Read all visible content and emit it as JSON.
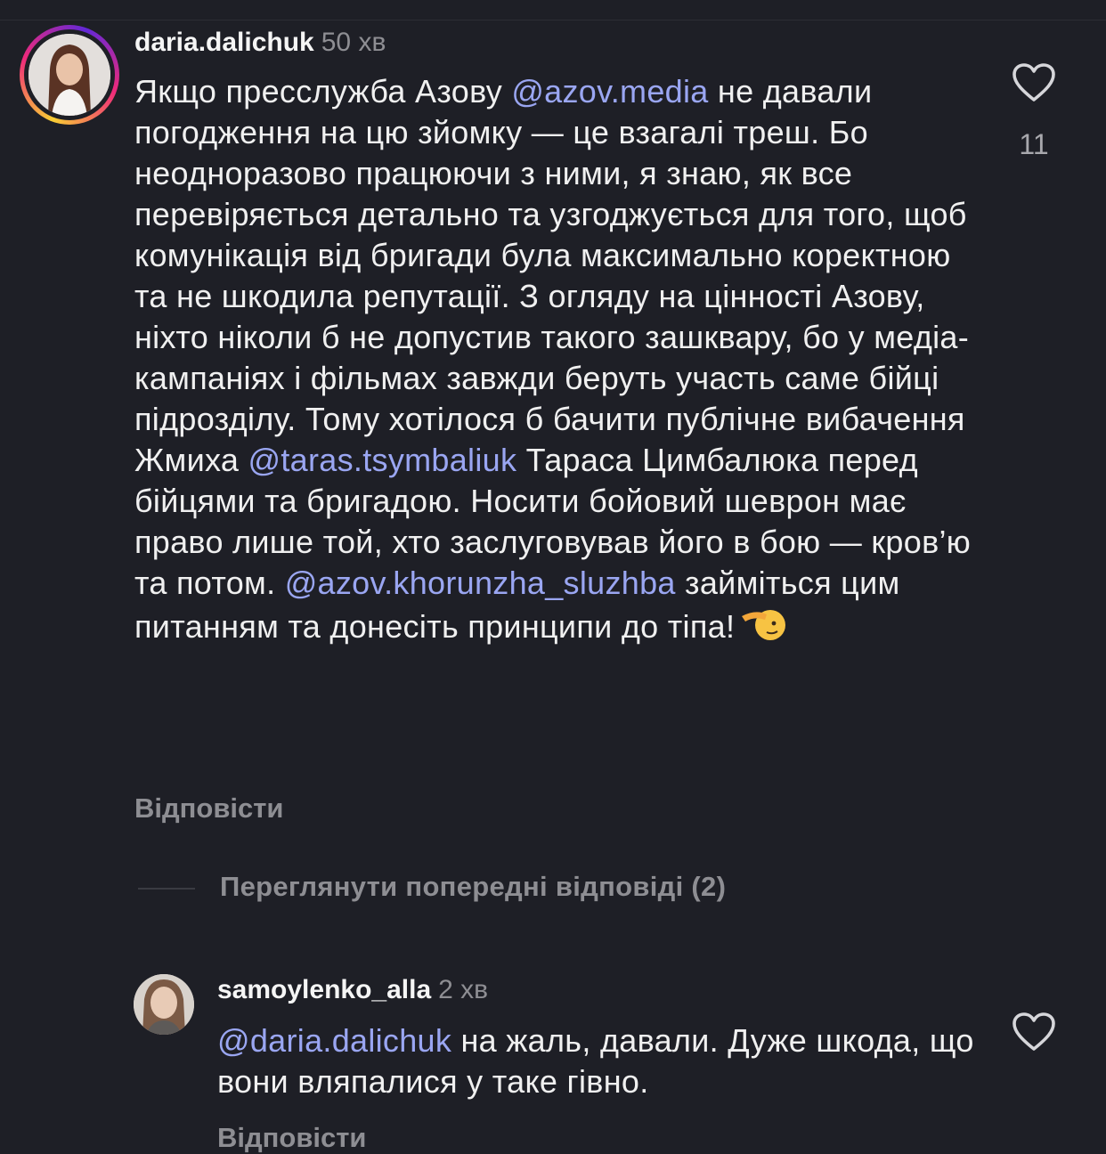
{
  "comments": [
    {
      "username": "daria.dalichuk",
      "time": "50 хв",
      "text_parts": {
        "p1": "Якщо пресслужба Азову ",
        "m1": "@azov.media",
        "p2": " не давали погодження на цю зйомку — це взагалі треш. Бо неодноразово працюючи з ними, я знаю, як все перевіряється детально та узгоджується для того, щоб комунікація від бригади була максимально коректною та не шкодила репутації. З огляду на цінності Азову, ніхто ніколи б не допустив такого зашквару, бо у медіа-кампаніях і фільмах завжди беруть участь саме бійці підрозділу. Тому хотілося б бачити публічне вибачення Жмиха ",
        "m2": "@taras.tsymbaliuk",
        "p3": " Тараса Цимбалюка перед бійцями та бригадою. Носити бойовий шеврон має право лише той, хто заслуговував його в бою — кров’ю та потом. ",
        "m3": "@azov.khorunzha_sluzhba",
        "p4": " займіться цим питанням та донесіть принципи до тіпа!"
      },
      "emoji_icon": "saluting-face-emoji",
      "likes": "11",
      "reply_label": "Відповісти"
    },
    {
      "username": "samoylenko_alla",
      "time": "2 хв",
      "text_parts": {
        "m1": "@daria.dalichuk",
        "p1": " на жаль, давали. Дуже шкода, що вони вляпалися у таке гівно."
      },
      "reply_label": "Відповісти"
    }
  ],
  "view_previous_label": "Переглянути попередні відповіді (2)",
  "icons": {
    "like": "heart-outline-icon"
  },
  "colors": {
    "background": "#1e1f26",
    "mention": "#9aa6f2",
    "muted": "#8e8e93"
  }
}
